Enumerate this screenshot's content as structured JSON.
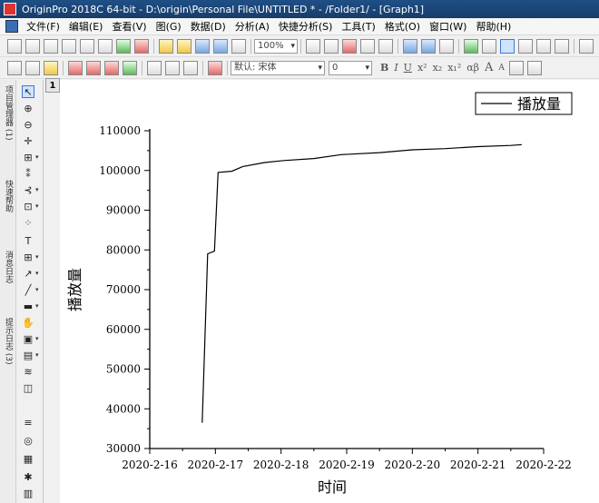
{
  "window": {
    "title": "OriginPro 2018C 64-bit - D:\\origin\\Personal File\\UNTITLED * - /Folder1/ - [Graph1]"
  },
  "menu": {
    "items": [
      "文件(F)",
      "编辑(E)",
      "查看(V)",
      "图(G)",
      "数据(D)",
      "分析(A)",
      "快捷分析(S)",
      "工具(T)",
      "格式(O)",
      "窗口(W)",
      "帮助(H)"
    ]
  },
  "toolbar": {
    "zoom": "100%",
    "font_name": "默认: 宋体",
    "font_size": "0",
    "format_labels": [
      "B",
      "I",
      "U",
      "x²",
      "x₂",
      "x₁²",
      "αβ",
      "A",
      "A"
    ]
  },
  "left_panel": {
    "tabs": [
      "项目管理器 (1)",
      "快速帮助",
      "消息日志",
      "提示日志 (3)"
    ]
  },
  "layer": {
    "index": "1"
  },
  "chart_data": {
    "type": "line",
    "xlabel": "时间",
    "ylabel": "播放量",
    "xticks": [
      "2020-2-16",
      "2020-2-17",
      "2020-2-18",
      "2020-2-19",
      "2020-2-20",
      "2020-2-21",
      "2020-2-22"
    ],
    "yticks": [
      "30000",
      "40000",
      "50000",
      "60000",
      "70000",
      "80000",
      "90000",
      "100000",
      "110000"
    ],
    "xlim": [
      "2020-02-16",
      "2020-02-22"
    ],
    "ylim": [
      30000,
      110000
    ],
    "legend_position": "top-right",
    "series": [
      {
        "name": "播放量",
        "color": "#000000",
        "points": [
          {
            "x": "2020-02-16 19:10",
            "y": 36500
          },
          {
            "x": "2020-02-16 21:10",
            "y": 79000
          },
          {
            "x": "2020-02-16 23:40",
            "y": 79700
          },
          {
            "x": "2020-02-17 01:00",
            "y": 99500
          },
          {
            "x": "2020-02-17 06:00",
            "y": 99800
          },
          {
            "x": "2020-02-17 10:00",
            "y": 101000
          },
          {
            "x": "2020-02-17 18:00",
            "y": 102000
          },
          {
            "x": "2020-02-18 01:00",
            "y": 102500
          },
          {
            "x": "2020-02-18 12:00",
            "y": 103000
          },
          {
            "x": "2020-02-18 22:00",
            "y": 104000
          },
          {
            "x": "2020-02-19 12:00",
            "y": 104500
          },
          {
            "x": "2020-02-20 00:00",
            "y": 105200
          },
          {
            "x": "2020-02-20 12:00",
            "y": 105500
          },
          {
            "x": "2020-02-21 00:00",
            "y": 106000
          },
          {
            "x": "2020-02-21 12:00",
            "y": 106300
          },
          {
            "x": "2020-02-21 16:00",
            "y": 106500
          }
        ]
      }
    ]
  }
}
